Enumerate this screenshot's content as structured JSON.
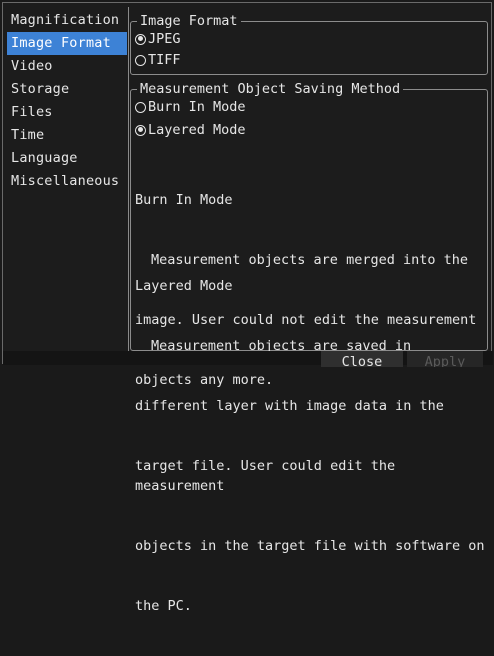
{
  "sidebar": {
    "items": [
      {
        "label": "Magnification"
      },
      {
        "label": "Image Format"
      },
      {
        "label": "Video"
      },
      {
        "label": "Storage"
      },
      {
        "label": "Files"
      },
      {
        "label": "Time"
      },
      {
        "label": "Language"
      },
      {
        "label": "Miscellaneous"
      }
    ],
    "selected_index": 1
  },
  "image_format": {
    "title": "Image Format",
    "options": [
      {
        "label": "JPEG",
        "checked": true
      },
      {
        "label": "TIFF",
        "checked": false
      }
    ]
  },
  "saving_method": {
    "title": "Measurement Object Saving Method",
    "options": [
      {
        "label": "Burn In Mode",
        "checked": false
      },
      {
        "label": "Layered Mode",
        "checked": true
      }
    ],
    "burn_in_heading": "Burn In Mode",
    "burn_in_text_1": "Measurement objects are merged into the",
    "burn_in_text_2": "image. User could not edit the measurement",
    "burn_in_text_3": "objects any more.",
    "layered_heading": "Layered Mode",
    "layered_text_1": "Measurement objects are saved in",
    "layered_text_2": "different layer with image data in the",
    "layered_text_3": "target file. User could edit the measurement",
    "layered_text_4": "objects in the target file with software on",
    "layered_text_5": "the PC."
  },
  "buttons": {
    "close_label": "Close",
    "apply_label": "Apply"
  },
  "colors": {
    "selection": "#3d82d6",
    "background": "#1c1c1c"
  }
}
